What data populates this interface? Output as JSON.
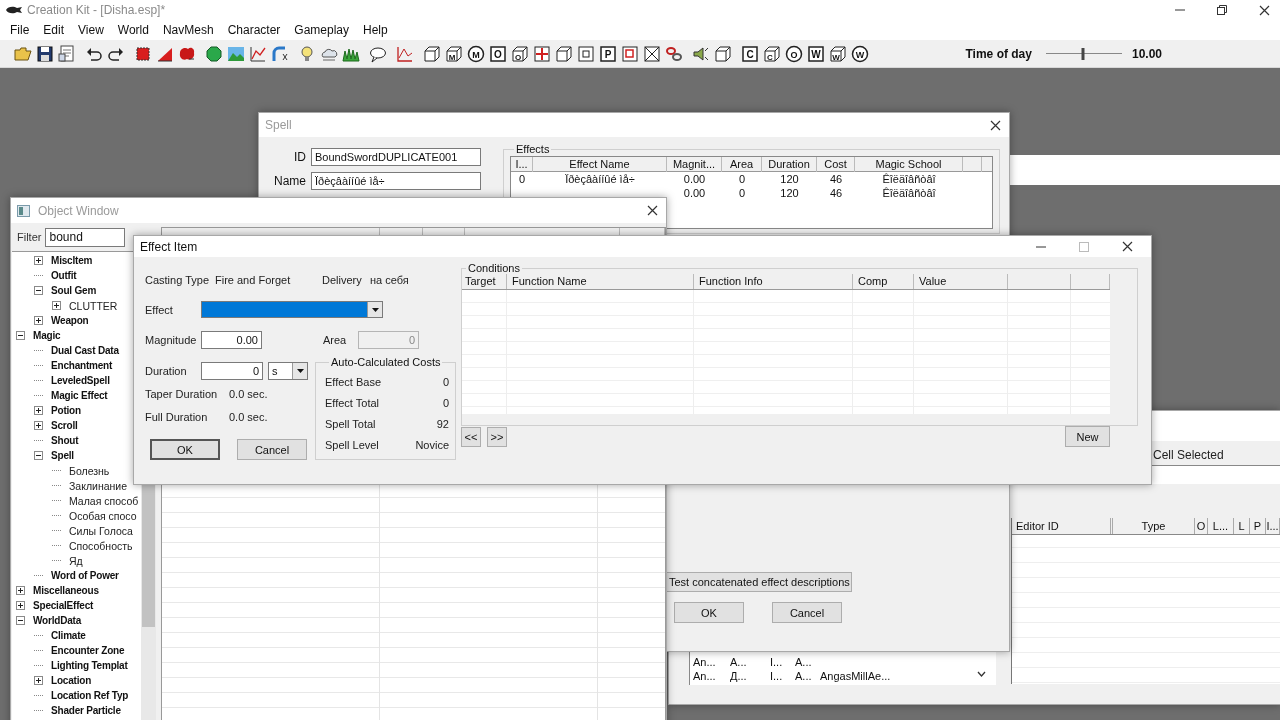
{
  "app": {
    "title": "Creation Kit - [Disha.esp]*"
  },
  "menu": [
    "File",
    "Edit",
    "View",
    "World",
    "NavMesh",
    "Character",
    "Gameplay",
    "Help"
  ],
  "toolbar": {
    "groups": [
      [
        {
          "kind": "folder"
        },
        {
          "kind": "save"
        },
        {
          "kind": "document"
        }
      ],
      [
        {
          "kind": "undo"
        },
        {
          "kind": "redo"
        }
      ],
      [
        {
          "kind": "square"
        },
        {
          "kind": "triangle"
        },
        {
          "kind": "blob"
        }
      ],
      [
        {
          "kind": "octagon"
        },
        {
          "kind": "landscape"
        },
        {
          "kind": "graph"
        },
        {
          "kind": "pipe"
        }
      ],
      [
        {
          "kind": "bulb"
        },
        {
          "kind": "sky"
        },
        {
          "kind": "grass"
        }
      ],
      [
        {
          "kind": "speech"
        }
      ],
      [
        {
          "kind": "chart"
        }
      ],
      [
        {
          "kind": "cube"
        },
        {
          "kind": "cube",
          "glyph": "M"
        },
        {
          "kind": "circle",
          "glyph": "M"
        },
        {
          "kind": "box",
          "glyph": "O"
        },
        {
          "kind": "cube",
          "glyph": "O"
        },
        {
          "kind": "cross"
        },
        {
          "kind": "cube"
        },
        {
          "kind": "frame"
        },
        {
          "kind": "box",
          "glyph": "P"
        },
        {
          "kind": "frame-red"
        },
        {
          "kind": "box-x"
        },
        {
          "kind": "chain"
        }
      ],
      [
        {
          "kind": "speaker"
        },
        {
          "kind": "cube"
        }
      ],
      [
        {
          "kind": "box",
          "glyph": "C"
        },
        {
          "kind": "cube",
          "glyph": "C"
        },
        {
          "kind": "circle",
          "glyph": "O"
        },
        {
          "kind": "box",
          "glyph": "W"
        },
        {
          "kind": "cube",
          "glyph": "W"
        },
        {
          "kind": "circle",
          "glyph": "W"
        }
      ]
    ],
    "time_of_day": {
      "label": "Time of day",
      "level": 0.49,
      "value": "10.00"
    }
  },
  "spell_window": {
    "title": "Spell",
    "fields": [
      {
        "label": "ID",
        "value": "BoundSwordDUPLICATE001"
      },
      {
        "label": "Name",
        "value": "Ïðèçâàííûé ìå÷"
      }
    ],
    "effects": {
      "title": "Effects",
      "columns": [
        "I...",
        "Effect Name",
        "Magnit...",
        "Area",
        "Duration",
        "Cost",
        "Magic School"
      ],
      "rows": [
        [
          "0",
          "Ïðèçâàííûé ìå÷",
          "0.00",
          "0",
          "120",
          "46",
          "Êîëäîâñòâî"
        ],
        [
          "",
          "",
          "0.00",
          "0",
          "120",
          "46",
          "Êîëäîâñòâî"
        ]
      ]
    },
    "describe_button": "Test concatenated effect descriptions",
    "buttons": [
      "OK",
      "Cancel"
    ]
  },
  "object_window": {
    "title": "Object Window",
    "filter": {
      "label": "Filter",
      "value": "bound"
    },
    "tree": [
      {
        "children": [
          {
            "label": "MiscItem",
            "kind": "type",
            "expanded": false
          },
          {
            "label": "Outfit",
            "kind": "type"
          },
          {
            "label": "Soul Gem",
            "kind": "type",
            "expanded": true,
            "children": [
              {
                "label": "CLUTTER",
                "kind": "folder",
                "expanded": false
              }
            ]
          },
          {
            "label": "Weapon",
            "kind": "type",
            "expanded": false
          }
        ]
      },
      {
        "label": "Magic",
        "kind": "type",
        "expanded": true,
        "children": [
          {
            "label": "Dual Cast Data",
            "kind": "type"
          },
          {
            "label": "Enchantment",
            "kind": "type"
          },
          {
            "label": "LeveledSpell",
            "kind": "type"
          },
          {
            "label": "Magic Effect",
            "kind": "type"
          },
          {
            "label": "Potion",
            "kind": "type",
            "expanded": false
          },
          {
            "label": "Scroll",
            "kind": "type",
            "expanded": false
          },
          {
            "label": "Shout",
            "kind": "type"
          },
          {
            "label": "Spell",
            "kind": "type",
            "expanded": true,
            "children": [
              {
                "label": "Болезнь",
                "kind": "folder"
              },
              {
                "label": "Заклинание",
                "kind": "folder"
              },
              {
                "label": "Малая способ",
                "kind": "folder"
              },
              {
                "label": "Особая спосо",
                "kind": "folder"
              },
              {
                "label": "Силы Голоса",
                "kind": "folder"
              },
              {
                "label": "Способность",
                "kind": "folder"
              },
              {
                "label": "Яд",
                "kind": "folder"
              }
            ]
          },
          {
            "label": "Word of Power",
            "kind": "type"
          }
        ]
      },
      {
        "label": "Miscellaneous",
        "kind": "type",
        "expanded": false
      },
      {
        "label": "SpecialEffect",
        "kind": "type",
        "expanded": false
      },
      {
        "label": "WorldData",
        "kind": "type",
        "expanded": true,
        "children": [
          {
            "label": "Climate",
            "kind": "type"
          },
          {
            "label": "Encounter Zone",
            "kind": "type"
          },
          {
            "label": "Lighting Templat",
            "kind": "type"
          },
          {
            "label": "Location",
            "kind": "type",
            "expanded": false
          },
          {
            "label": "Location Ref Typ",
            "kind": "type"
          },
          {
            "label": "Shader Particle",
            "kind": "type"
          }
        ]
      }
    ]
  },
  "effect_item": {
    "title": "Effect Item",
    "casting_type": {
      "label": "Casting Type",
      "value": "Fire and Forget"
    },
    "delivery": {
      "label": "Delivery",
      "value": "на себя"
    },
    "effect": {
      "label": "Effect",
      "focused": true
    },
    "magnitude": {
      "label": "Magnitude",
      "value": "0.00"
    },
    "area": {
      "label": "Area",
      "value": "0",
      "disabled": true
    },
    "duration": {
      "label": "Duration",
      "value": "0",
      "unit": "s"
    },
    "taper_duration": {
      "label": "Taper Duration",
      "value": "0.0 sec."
    },
    "full_duration": {
      "label": "Full Duration",
      "value": "0.0 sec."
    },
    "buttons": [
      "OK",
      "Cancel"
    ],
    "costs": {
      "title": "Auto-Calculated Costs",
      "rows": [
        {
          "label": "Effect Base",
          "value": "0"
        },
        {
          "label": "Effect Total",
          "value": "0"
        },
        {
          "label": "Spell Total",
          "value": "92"
        },
        {
          "label": "Spell Level",
          "value": "Novice"
        }
      ]
    },
    "conditions": {
      "title": "Conditions",
      "columns": [
        "Target",
        "Function Name",
        "Function Info",
        "Comp",
        "Value"
      ]
    },
    "nav_buttons": [
      "<<",
      ">>"
    ],
    "new_button": "New"
  },
  "cell_window": {
    "header": "Cell Selected",
    "list_rows": [
      [
        "An...",
        "A...",
        "I...",
        "A..."
      ],
      [
        "An...",
        "Д...",
        "I...",
        "A...",
        "AngasMillAe..."
      ]
    ],
    "columns": [
      "Editor ID",
      "Type",
      "O",
      "L...",
      "L",
      "P",
      "I..."
    ]
  }
}
